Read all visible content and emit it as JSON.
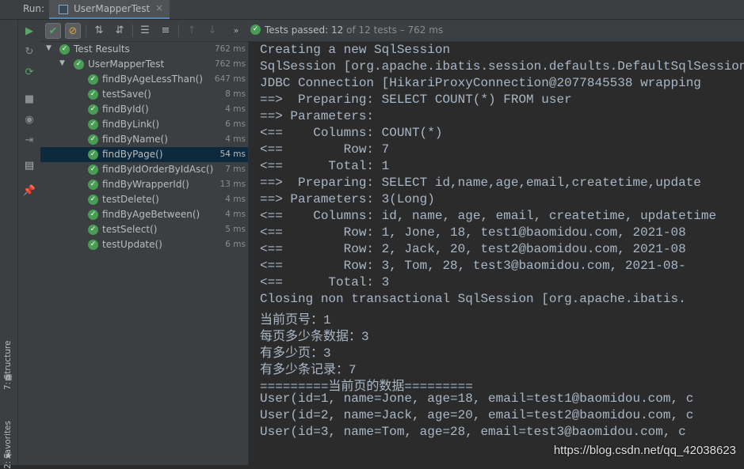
{
  "run_label": "Run:",
  "tab": {
    "label": "UserMapperTest",
    "close": "×"
  },
  "tool_strip": {
    "structure": "7: Structure",
    "favorites": "2: Favorites"
  },
  "status": {
    "prefix": "Tests passed: ",
    "passed": "12",
    "mid": " of 12 tests – ",
    "duration": "762 ms"
  },
  "tree": {
    "root": {
      "label": "Test Results",
      "time": "762 ms"
    },
    "suite": {
      "label": "UserMapperTest",
      "time": "762 ms"
    },
    "tests": [
      {
        "label": "findByAgeLessThan()",
        "time": "647 ms"
      },
      {
        "label": "testSave()",
        "time": "8 ms"
      },
      {
        "label": "findById()",
        "time": "4 ms"
      },
      {
        "label": "findByLink()",
        "time": "6 ms"
      },
      {
        "label": "findByName()",
        "time": "4 ms"
      },
      {
        "label": "findByPage()",
        "time": "54 ms",
        "selected": true
      },
      {
        "label": "findByIdOrderByIdAsc()",
        "time": "7 ms"
      },
      {
        "label": "findByWrapperId()",
        "time": "13 ms"
      },
      {
        "label": "testDelete()",
        "time": "4 ms"
      },
      {
        "label": "findByAgeBetween()",
        "time": "4 ms"
      },
      {
        "label": "testSelect()",
        "time": "5 ms"
      },
      {
        "label": "testUpdate()",
        "time": "6 ms"
      }
    ]
  },
  "console": [
    "Creating a new SqlSession",
    "SqlSession [org.apache.ibatis.session.defaults.DefaultSqlSession",
    "JDBC Connection [HikariProxyConnection@2077845538 wrapping",
    "==>  Preparing: SELECT COUNT(*) FROM user",
    "==> Parameters: ",
    "<==    Columns: COUNT(*)",
    "<==        Row: 7",
    "<==      Total: 1",
    "==>  Preparing: SELECT id,name,age,email,createtime,update",
    "==> Parameters: 3(Long)",
    "<==    Columns: id, name, age, email, createtime, updatetime",
    "<==        Row: 1, Jone, 18, test1@baomidou.com, 2021-08",
    "<==        Row: 2, Jack, 20, test2@baomidou.com, 2021-08",
    "<==        Row: 3, Tom, 28, test3@baomidou.com, 2021-08-",
    "<==      Total: 3",
    "Closing non transactional SqlSession [org.apache.ibatis.",
    "当前页号：1",
    "每页多少条数据：3",
    "有多少页：3",
    "有多少条记录：7",
    "=========当前页的数据=========",
    "User(id=1, name=Jone, age=18, email=test1@baomidou.com, c",
    "User(id=2, name=Jack, age=20, email=test2@baomidou.com, c",
    "User(id=3, name=Tom, age=28, email=test3@baomidou.com, c"
  ],
  "watermark": "https://blog.csdn.net/qq_42038623"
}
